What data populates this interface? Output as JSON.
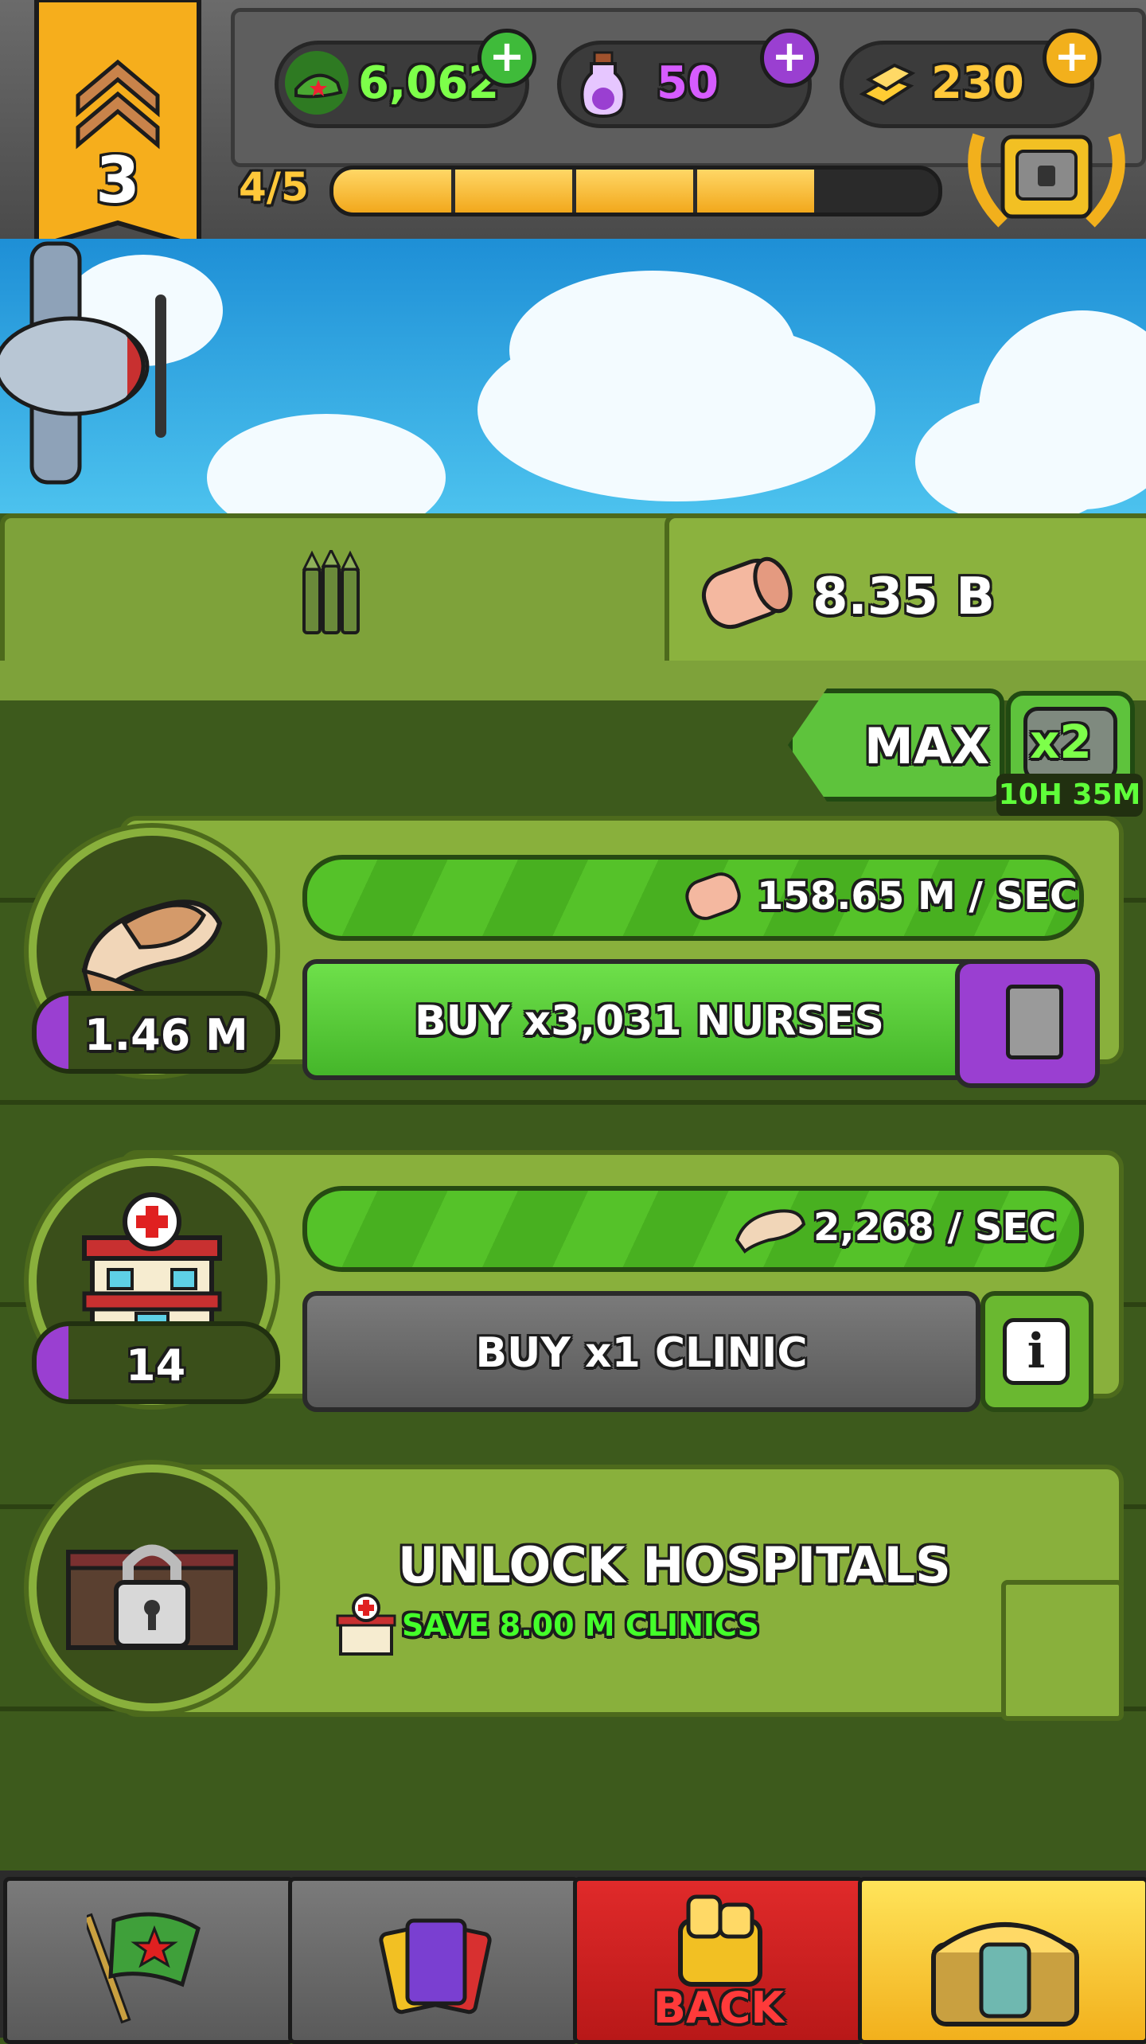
{
  "rank": {
    "level": "3"
  },
  "currencies": [
    {
      "name": "cash",
      "value": "6,062",
      "color": "#7dff4a",
      "icon": "army-cap-icon"
    },
    {
      "name": "potion",
      "value": "50",
      "color": "#d65cff",
      "icon": "potion-icon"
    },
    {
      "name": "gold",
      "value": "230",
      "color": "#ffc83a",
      "icon": "gold-bars-icon"
    }
  ],
  "progress": {
    "label": "4/5",
    "current": 4,
    "total": 5
  },
  "resource": {
    "value": "8.35 B",
    "icon": "bandage-roll-icon"
  },
  "multiplier": {
    "max_label": "MAX",
    "boost_label": "x2",
    "timer": "10H 35M"
  },
  "generators": [
    {
      "name": "nurses",
      "icon": "bandage-icon",
      "count": "1.46 M",
      "rate": "158.65 M / SEC",
      "rate_icon": "bandage-roll-icon",
      "buy_label": "BUY x3,031 NURSES"
    },
    {
      "name": "clinic",
      "icon": "clinic-icon",
      "count": "14",
      "rate": "2,268 / SEC",
      "rate_icon": "bandage-icon",
      "buy_label": "BUY x1 CLINIC"
    }
  ],
  "locked": {
    "title": "UNLOCK HOSPITALS",
    "subtitle": "SAVE 8.00 M CLINICS"
  },
  "nav": {
    "back_label": "BACK"
  }
}
